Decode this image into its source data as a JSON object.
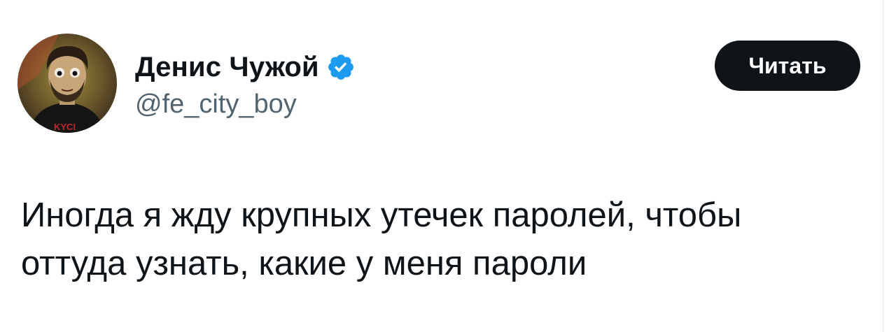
{
  "author": {
    "display_name": "Денис Чужой",
    "handle": "@fe_city_boy",
    "verified": true,
    "avatar_icon": "cartoon-portrait-avatar",
    "avatar_shirt_text": "KYCI"
  },
  "follow_button": {
    "label": "Читать"
  },
  "tweet": {
    "lines": [
      "Иногда я жду крупных утечек паролей, чтобы",
      "оттуда узнать, какие у меня пароли"
    ]
  },
  "colors": {
    "text_primary": "#0f1419",
    "text_secondary": "#536471",
    "verified_blue": "#1d9bf0",
    "button_bg": "#0f1419",
    "button_text": "#ffffff"
  }
}
